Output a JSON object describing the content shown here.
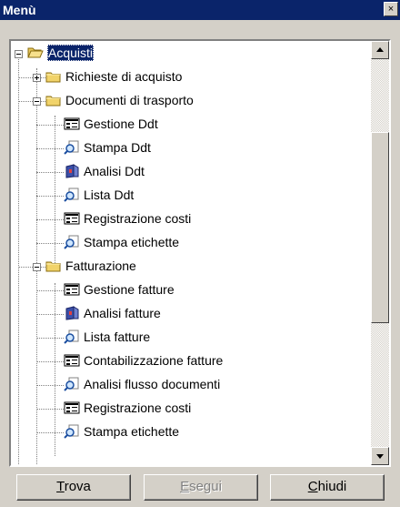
{
  "window": {
    "title": "Menù",
    "close_glyph": "×"
  },
  "tree": {
    "root": {
      "label": "Acquisti",
      "expanded": true,
      "selected": true,
      "icon": "folder-open-icon"
    },
    "items": [
      {
        "label": "Richieste di acquisto",
        "icon": "folder-icon",
        "expander": "+"
      },
      {
        "label": "Documenti di trasporto",
        "icon": "folder-icon",
        "expander": "-"
      },
      {
        "label": "Gestione Ddt",
        "icon": "form-icon"
      },
      {
        "label": "Stampa Ddt",
        "icon": "magnifier-icon"
      },
      {
        "label": "Analisi Ddt",
        "icon": "analysis-icon"
      },
      {
        "label": "Lista Ddt",
        "icon": "magnifier-icon"
      },
      {
        "label": "Registrazione costi",
        "icon": "form-icon"
      },
      {
        "label": "Stampa etichette",
        "icon": "magnifier-icon"
      },
      {
        "label": "Fatturazione",
        "icon": "folder-icon",
        "expander": "-"
      },
      {
        "label": "Gestione fatture",
        "icon": "form-icon"
      },
      {
        "label": "Analisi fatture",
        "icon": "analysis-icon"
      },
      {
        "label": "Lista fatture",
        "icon": "magnifier-icon"
      },
      {
        "label": "Contabilizzazione fatture",
        "icon": "form-icon"
      },
      {
        "label": "Analisi flusso documenti",
        "icon": "magnifier-icon"
      },
      {
        "label": "Registrazione costi",
        "icon": "form-icon"
      },
      {
        "label": "Stampa etichette",
        "icon": "magnifier-icon"
      }
    ]
  },
  "buttons": {
    "find": {
      "accel": "T",
      "rest": "rova"
    },
    "run": {
      "accel": "E",
      "rest": "segui",
      "disabled": true
    },
    "close": {
      "accel": "C",
      "rest": "hiudi"
    }
  }
}
